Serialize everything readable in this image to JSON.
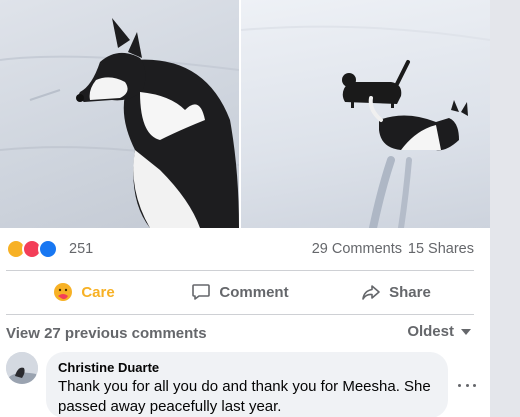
{
  "post": {
    "photos": [
      {
        "icon": "dog-in-snow-photo"
      },
      {
        "icon": "two-dogs-in-snow-photo"
      }
    ],
    "reactions": {
      "icons": [
        "care-emoji",
        "love-emoji",
        "like-emoji"
      ],
      "count": "251",
      "comments": "29 Comments",
      "shares": "15 Shares"
    },
    "actions": {
      "care_label": "Care",
      "comment_label": "Comment",
      "share_label": "Share"
    },
    "comments_section": {
      "view_previous": "View 27 previous comments",
      "sort": "Oldest"
    },
    "comment": {
      "author": "Christine Duarte",
      "text": "Thank you for all you do and thank you for Meesha. She passed away peacefully last year."
    }
  },
  "colors": {
    "care": "#f7b125",
    "love": "#f33e58",
    "like": "#1877f2",
    "secondary_text": "#65676b"
  }
}
